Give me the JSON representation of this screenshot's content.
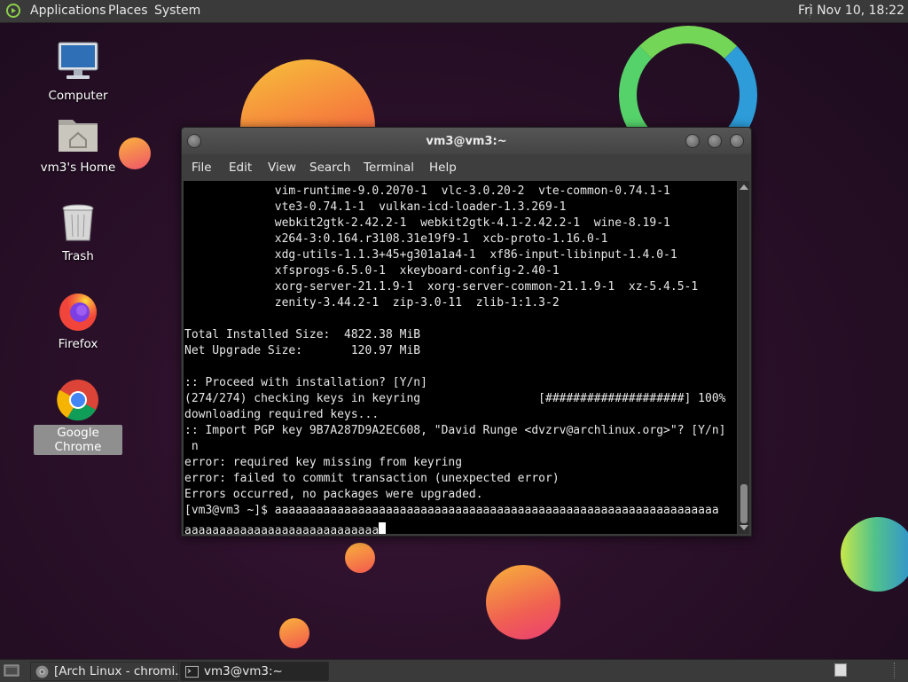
{
  "top_panel": {
    "menus": [
      "Applications",
      "Places",
      "System"
    ],
    "clock": "Fri Nov 10, 18:22"
  },
  "desktop_icons": [
    {
      "label": "Computer",
      "icon": "computer-icon"
    },
    {
      "label": "vm3's Home",
      "icon": "home-folder-icon"
    },
    {
      "label": "Trash",
      "icon": "trash-icon"
    },
    {
      "label": "Firefox",
      "icon": "firefox-icon"
    },
    {
      "label": "Google Chrome",
      "icon": "chrome-icon",
      "selected": true
    }
  ],
  "terminal": {
    "title": "vm3@vm3:~",
    "menus": [
      "File",
      "Edit",
      "View",
      "Search",
      "Terminal",
      "Help"
    ],
    "lines": [
      "             vim-runtime-9.0.2070-1  vlc-3.0.20-2  vte-common-0.74.1-1",
      "             vte3-0.74.1-1  vulkan-icd-loader-1.3.269-1",
      "             webkit2gtk-2.42.2-1  webkit2gtk-4.1-2.42.2-1  wine-8.19-1",
      "             x264-3:0.164.r3108.31e19f9-1  xcb-proto-1.16.0-1",
      "             xdg-utils-1.1.3+45+g301a1a4-1  xf86-input-libinput-1.4.0-1",
      "             xfsprogs-6.5.0-1  xkeyboard-config-2.40-1",
      "             xorg-server-21.1.9-1  xorg-server-common-21.1.9-1  xz-5.4.5-1",
      "             zenity-3.44.2-1  zip-3.0-11  zlib-1:1.3-2",
      "",
      "Total Installed Size:  4822.38 MiB",
      "Net Upgrade Size:       120.97 MiB",
      "",
      ":: Proceed with installation? [Y/n]",
      "(274/274) checking keys in keyring                 [####################] 100%",
      "downloading required keys...",
      ":: Import PGP key 9B7A287D9A2EC608, \"David Runge <dvzrv@archlinux.org>\"? [Y/n]",
      " n",
      "error: required key missing from keyring",
      "error: failed to commit transaction (unexpected error)",
      "Errors occurred, no packages were upgraded.",
      "[vm3@vm3 ~]$ aaaaaaaaaaaaaaaaaaaaaaaaaaaaaaaaaaaaaaaaaaaaaaaaaaaaaaaaaaaaaaaa"
    ],
    "input_line": "aaaaaaaaaaaaaaaaaaaaaaaaaaaa"
  },
  "taskbar": {
    "tasks": [
      {
        "label": "[Arch Linux - chromi...",
        "icon": "chrome-icon"
      },
      {
        "label": "vm3@vm3:~",
        "icon": "terminal-icon",
        "active": true
      }
    ]
  }
}
